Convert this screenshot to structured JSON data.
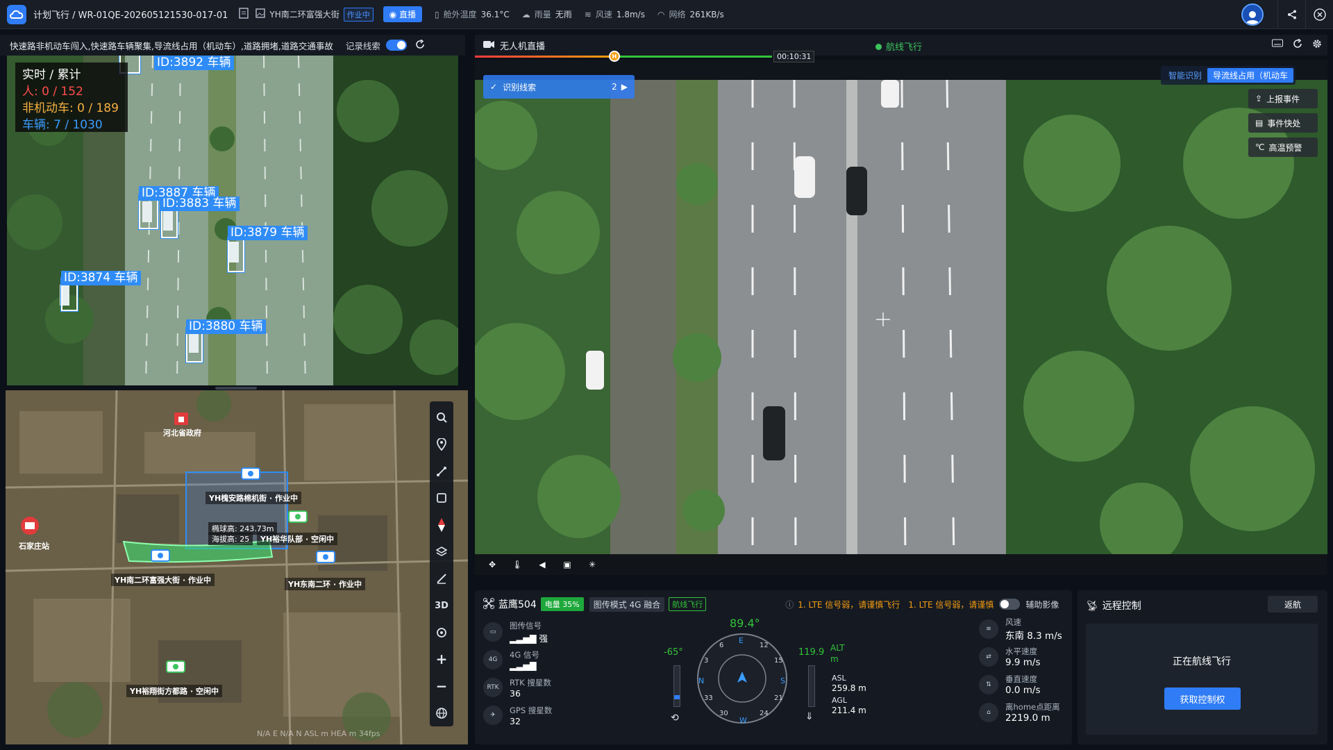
{
  "topbar": {
    "title": "计划飞行 / WR-01QE-202605121530-017-01",
    "task_name": "YH南二环富强大街",
    "task_status": "作业中",
    "live_label": "直播",
    "cabin_temp_label": "舱外温度",
    "cabin_temp_value": "36.1°C",
    "rain_label": "雨量",
    "rain_value": "无雨",
    "wind_label": "风速",
    "wind_value": "1.8m/s",
    "network_label": "网络",
    "network_value": "261KB/s"
  },
  "left": {
    "alert_text": "快速路非机动车闯入,快速路车辆聚集,导流线占用（机动车）,道路拥堵,道路交通事故",
    "record_label": "记录线索",
    "stats_title": "实时 / 累计",
    "stats_person": "人: 0 / 152",
    "stats_nonmotor": "非机动车: 0 / 189",
    "stats_vehicle": "车辆: 7 / 1030",
    "detections": [
      "ID:3892 车辆",
      "ID:3887 车辆",
      "ID:3883 车辆",
      "ID:3879 车辆",
      "ID:3874 车辆",
      "ID:3880 车辆"
    ]
  },
  "map": {
    "labels": {
      "provincial_gov": "河北省政府",
      "shijiazhuang_station": "石家庄站",
      "station_a": "YH槐安路棉机街 · 作业中",
      "station_b": "YH裕华队部 · 空闲中",
      "station_c": "YH南二环富强大街 · 作业中",
      "station_d": "YH东南二环 · 作业中",
      "station_e": "YH裕翔街方都路 · 空闲中",
      "ellipsoid_height": "椭球高: 243.73m",
      "sea_height": "海拔高: 25"
    },
    "tools": [
      "search-icon",
      "location-pin-icon",
      "route-icon",
      "polygon-icon",
      "compass-icon",
      "layers-icon",
      "measure-icon",
      "3D",
      "target-icon",
      "+",
      "−",
      "globe-icon"
    ],
    "tool_3d": "3D",
    "footer": "N/A E   N/A N   ASL    m   HEA    m   34fps"
  },
  "live": {
    "title": "无人机直播",
    "flight_status": "航线飞行",
    "progress_time": "00:10:31",
    "progress_fraction": 0.47,
    "clue_label": "识别线索",
    "clue_count": "2",
    "ai_recognition": "智能识别",
    "ai_mode": "导流线占用（机动车",
    "event_report": "上报事件",
    "event_fast": "事件快处",
    "high_temp": "高温预警"
  },
  "telemetry": {
    "drone_name": "蓝鹰504",
    "battery_label": "电量 35%",
    "transmit_mode": "图传模式  4G 融合",
    "route_flight": "航线飞行",
    "warn1": "1. LTE 信号弱，请谨慎飞行",
    "warn2": "1. LTE 信号弱，请谨慎",
    "aux_image": "辅助影像",
    "signals": [
      {
        "k": "图传信号",
        "v": "强"
      },
      {
        "k": "4G 信号",
        "v": ""
      },
      {
        "k": "RTK 搜星数",
        "v": "36"
      },
      {
        "k": "GPS 搜星数",
        "v": "32"
      }
    ],
    "heading": "89.4°",
    "pitch": "-65°",
    "alt_value": "119.9",
    "alt_label": "ALT",
    "alt_unit": "m",
    "asl_label": "ASL",
    "asl_value": "259.8 m",
    "agl_label": "AGL",
    "agl_value": "211.4 m",
    "compass": [
      "E",
      "6",
      "12",
      "15",
      "S",
      "21",
      "24",
      "W",
      "30",
      "33",
      "N",
      "3"
    ],
    "rt": [
      {
        "k": "风速",
        "v": "东南 8.3 m/s"
      },
      {
        "k": "水平速度",
        "v": "9.9 m/s"
      },
      {
        "k": "垂直速度",
        "v": "0.0 m/s"
      },
      {
        "k": "离home点距离",
        "v": "2219.0 m"
      }
    ]
  },
  "remote": {
    "title": "远程控制",
    "back": "返航",
    "status": "正在航线飞行",
    "acquire": "获取控制权"
  },
  "colors": {
    "accent": "#2f7cf6",
    "ok": "#33c33a",
    "warn": "#f39c12"
  }
}
